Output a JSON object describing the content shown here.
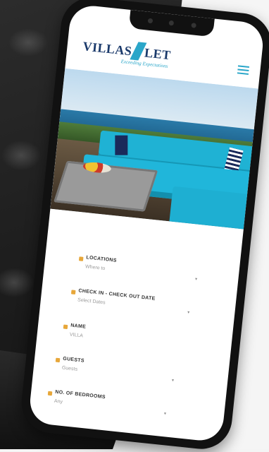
{
  "brand": {
    "logo_left": "VILLAS",
    "logo_right": "LET",
    "tagline": "Exceeding Expectations"
  },
  "colors": {
    "accent": "#2aa6c9",
    "brand_navy": "#1b3a6b",
    "field_icon": "#e7a73a"
  },
  "header": {
    "menu_icon": "hamburger-icon"
  },
  "hero": {
    "alt": ""
  },
  "form": {
    "fields": [
      {
        "label": "LOCATIONS",
        "placeholder": "Where to"
      },
      {
        "label": "CHECK IN - CHECK OUT DATE",
        "placeholder": "Select Dates"
      },
      {
        "label": "NAME",
        "placeholder": "VILLA"
      },
      {
        "label": "GUESTS",
        "placeholder": "Guests"
      },
      {
        "label": "NO. OF BEDROOMS",
        "placeholder": "Any"
      }
    ]
  }
}
